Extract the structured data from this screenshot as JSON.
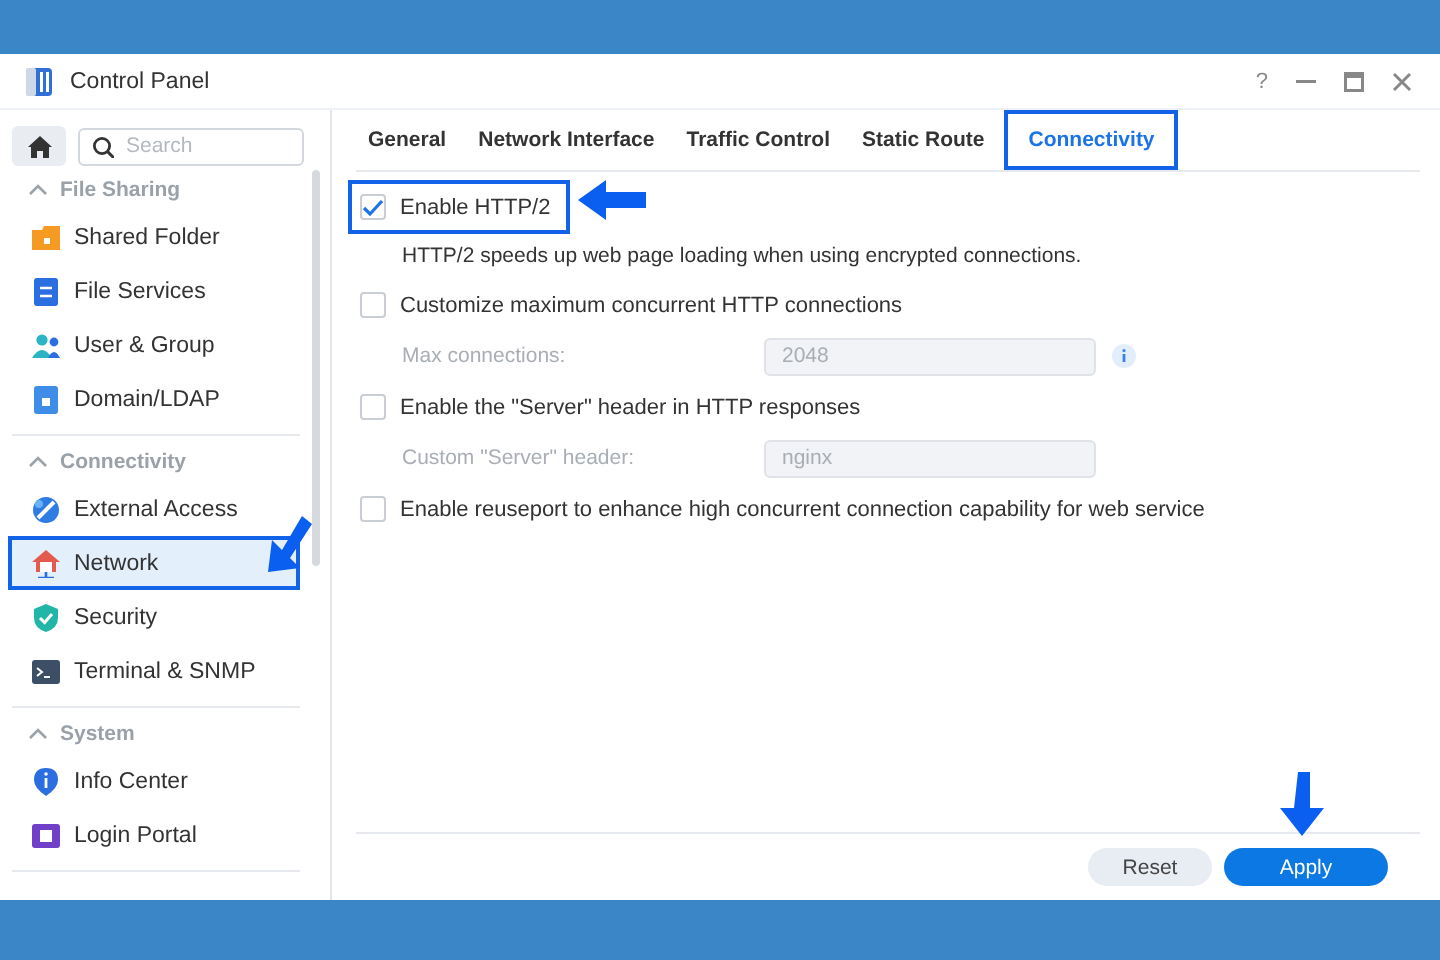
{
  "window": {
    "title": "Control Panel",
    "help": "?"
  },
  "sidebar": {
    "search": {
      "placeholder": "Search"
    },
    "groups": [
      {
        "title": "File Sharing",
        "expanded": true,
        "items": [
          {
            "label": "Shared Folder",
            "selected": false
          },
          {
            "label": "File Services",
            "selected": false
          },
          {
            "label": "User & Group",
            "selected": false
          },
          {
            "label": "Domain/LDAP",
            "selected": false
          }
        ]
      },
      {
        "title": "Connectivity",
        "expanded": true,
        "items": [
          {
            "label": "External Access",
            "selected": false
          },
          {
            "label": "Network",
            "selected": true,
            "highlight_box": true,
            "pointer": true
          },
          {
            "label": "Security",
            "selected": false
          },
          {
            "label": "Terminal & SNMP",
            "selected": false
          }
        ]
      },
      {
        "title": "System",
        "expanded": true,
        "items": [
          {
            "label": "Info Center",
            "selected": false
          },
          {
            "label": "Login Portal",
            "selected": false
          }
        ]
      }
    ]
  },
  "tabs": [
    {
      "label": "General",
      "selected": false
    },
    {
      "label": "Network Interface",
      "selected": false
    },
    {
      "label": "Traffic Control",
      "selected": false
    },
    {
      "label": "Static Route",
      "selected": false
    },
    {
      "label": "Connectivity",
      "selected": true,
      "highlight_box": true
    }
  ],
  "settings": [
    {
      "kind": "checkbox",
      "label": "Enable HTTP/2",
      "checked": true,
      "highlight_box": true,
      "pointer": true
    },
    {
      "kind": "note",
      "text": "HTTP/2 speeds up web page loading when using encrypted connections."
    },
    {
      "kind": "checkbox",
      "label": "Customize maximum concurrent HTTP connections",
      "checked": false
    },
    {
      "kind": "field",
      "label": "Max connections:",
      "value": "2048",
      "disabled": true,
      "info": true
    },
    {
      "kind": "checkbox",
      "label": "Enable the \"Server\" header in HTTP responses",
      "checked": false
    },
    {
      "kind": "field",
      "label": "Custom \"Server\" header:",
      "value": "nginx",
      "disabled": true,
      "info": false
    },
    {
      "kind": "checkbox",
      "label": "Enable reuseport to enhance high concurrent connection capability for web service",
      "checked": false
    }
  ],
  "buttons": [
    {
      "label": "Reset",
      "kind": "secondary"
    },
    {
      "label": "Apply",
      "kind": "primary",
      "pointer": true
    }
  ]
}
